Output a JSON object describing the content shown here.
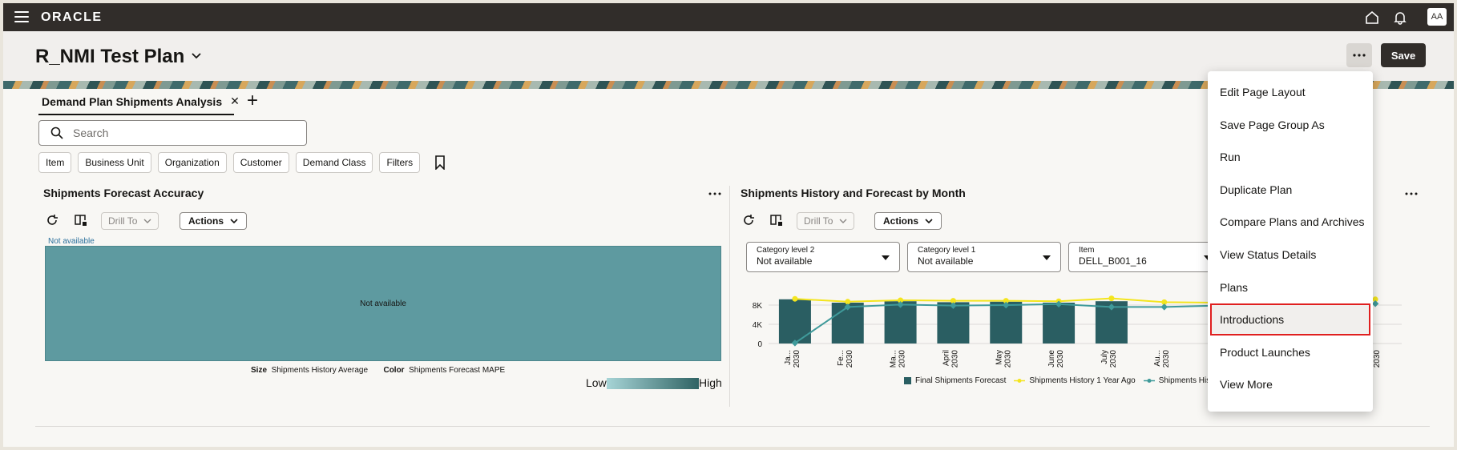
{
  "app": {
    "logo": "ORACLE",
    "avatar": "AA"
  },
  "header": {
    "title": "R_NMI Test Plan",
    "save_label": "Save",
    "more_label": "···"
  },
  "tabs": [
    {
      "label": "Demand Plan Shipments Analysis"
    }
  ],
  "search": {
    "placeholder": "Search"
  },
  "filters": [
    "Item",
    "Business Unit",
    "Organization",
    "Customer",
    "Demand Class",
    "Filters"
  ],
  "left_panel": {
    "title": "Shipments Forecast Accuracy",
    "drill_label": "Drill To",
    "actions_label": "Actions",
    "not_available_link": "Not available",
    "treemap_text": "Not available",
    "size_label": "Size",
    "size_value": "Shipments History Average",
    "color_label": "Color",
    "color_value": "Shipments Forecast MAPE",
    "low_label": "Low",
    "high_label": "High"
  },
  "right_panel": {
    "title": "Shipments History and Forecast by Month",
    "drill_label": "Drill To",
    "actions_label": "Actions",
    "selectors": [
      {
        "label": "Category level 2",
        "value": "Not available"
      },
      {
        "label": "Category level 1",
        "value": "Not available"
      },
      {
        "label": "Item",
        "value": "DELL_B001_16"
      }
    ]
  },
  "chart_data": {
    "type": "bar",
    "categories": [
      "Ja... 2030",
      "Fe... 2030",
      "Ma... 2030",
      "April 2030",
      "May 2030",
      "June 2030",
      "July 2030",
      "Au... 2030",
      "",
      "",
      "",
      "De... 2030"
    ],
    "yticks": [
      "0",
      "4K",
      "8K"
    ],
    "ylim": [
      0,
      10000
    ],
    "series": [
      {
        "name": "Final Shipments Forecast",
        "kind": "bar",
        "color": "#2a5e62",
        "values": [
          9200,
          8500,
          8800,
          8600,
          8700,
          8500,
          8800,
          null,
          null,
          null,
          null,
          null
        ]
      },
      {
        "name": "Shipments History 1 Year Ago",
        "kind": "line",
        "color": "#f4e51e",
        "values": [
          9300,
          8700,
          9000,
          8900,
          8900,
          8800,
          9400,
          8600,
          8500,
          8700,
          8900,
          9200
        ]
      },
      {
        "name": "Shipments His...",
        "kind": "line",
        "color": "#3f9a9a",
        "values": [
          100,
          7600,
          8100,
          7900,
          8000,
          8200,
          7600,
          7600,
          7900,
          8100,
          8200,
          8300
        ]
      }
    ]
  },
  "menu": {
    "items": [
      "Edit Page Layout",
      "Save Page Group As",
      "Run",
      "Duplicate Plan",
      "Compare Plans and Archives",
      "View Status Details",
      "Plans",
      "Introductions",
      "Product Launches",
      "View More"
    ],
    "highlighted": "Introductions"
  }
}
